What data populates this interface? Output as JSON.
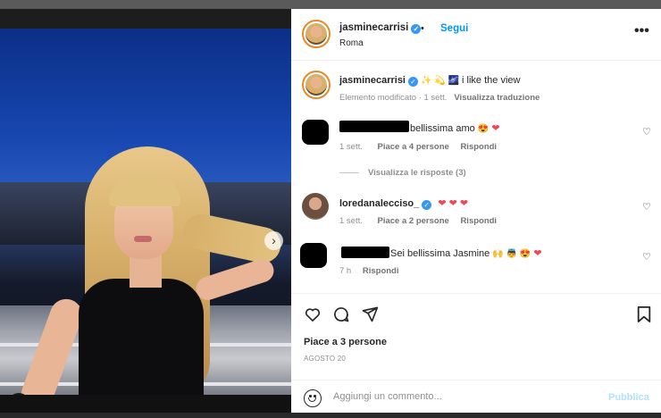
{
  "post": {
    "username": "jasminecarrisi",
    "follow_label": "Segui",
    "bullet": "•",
    "location": "Roma",
    "caption_emojis": "✨ 💫 🌌",
    "caption_text": "i like the view",
    "caption_meta_time": "Elemento modificato · 1 sett.",
    "caption_meta_translate": "Visualizza traduzione",
    "likes": "Piace a 3 persone",
    "date": "AGOSTO 20",
    "more_icon": "•••"
  },
  "comments": [
    {
      "text": "bellissima amo",
      "emojis": "😍",
      "heart": "❤",
      "time": "1 sett.",
      "likes": "Piace a 4 persone",
      "reply": "Rispondi"
    },
    {
      "username": "loredanalecciso_",
      "hearts": "❤ ❤ ❤",
      "time": "1 sett.",
      "likes": "Piace a 2 persone",
      "reply": "Rispondi"
    },
    {
      "text": "Sei bellissima Jasmine",
      "emojis": "🙌 👼 😍",
      "heart": "❤",
      "time": "7 h",
      "reply": "Rispondi"
    }
  ],
  "view_replies": "Visualizza le risposte (3)",
  "composer": {
    "placeholder": "Aggiungi un commento...",
    "publish_label": "Pubblica"
  },
  "icons": {
    "like": "heart-outline-icon",
    "comment": "comment-icon",
    "share": "paper-plane-icon",
    "save": "bookmark-icon",
    "next": "chevron-right-icon"
  },
  "colors": {
    "accent_blue": "#0095f6",
    "publish_disabled": "#b2dffc",
    "heart_red": "#ed4956"
  }
}
